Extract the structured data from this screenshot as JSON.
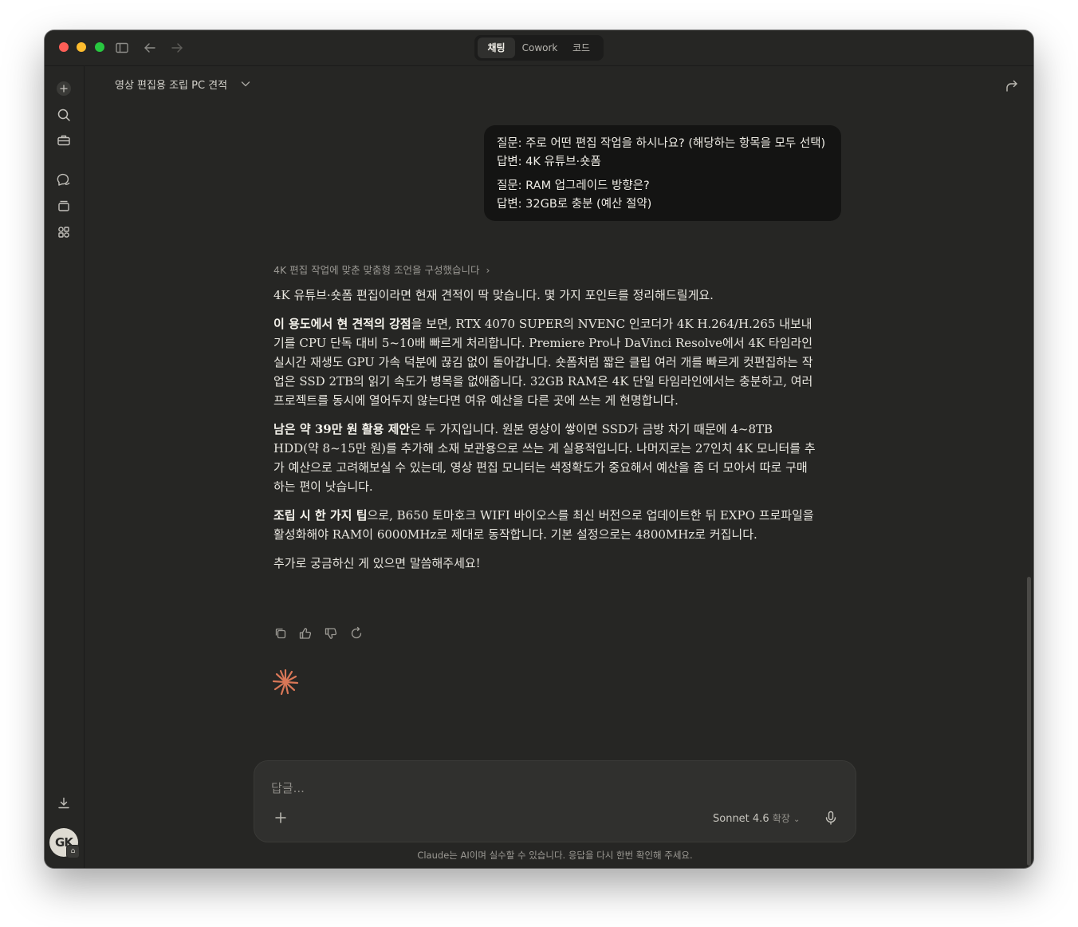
{
  "titlebar": {
    "modes": [
      "채팅",
      "Cowork",
      "코드"
    ],
    "active_mode": "채팅"
  },
  "conversation": {
    "title": "영상 편집용 조립 PC 견적"
  },
  "user_message": {
    "q1": "질문: 주로 어떤 편집 작업을 하시나요? (해당하는 항목을 모두 선택)",
    "a1": "답변: 4K 유튜브·숏폼",
    "q2": "질문: RAM 업그레이드 방향은?",
    "a2": "답변: 32GB로 충분 (예산 절약)"
  },
  "assistant": {
    "thinking": "4K 편집 작업에 맞춘 맞춤형 조언을 구성했습니다",
    "p1": "4K 유튜브·숏폼 편집이라면 현재 견적이 딱 맞습니다. 몇 가지 포인트를 정리해드릴게요.",
    "p2_bold": "이 용도에서 현 견적의 강점",
    "p2_rest": "을 보면, RTX 4070 SUPER의 NVENC 인코더가 4K H.264/H.265 내보내기를 CPU 단독 대비 5~10배 빠르게 처리합니다. Premiere Pro나 DaVinci Resolve에서 4K 타임라인 실시간 재생도 GPU 가속 덕분에 끊김 없이 돌아갑니다. 숏폼처럼 짧은 클립 여러 개를 빠르게 컷편집하는 작업은 SSD 2TB의 읽기 속도가 병목을 없애줍니다. 32GB RAM은 4K 단일 타임라인에서는 충분하고, 여러 프로젝트를 동시에 열어두지 않는다면 여유 예산을 다른 곳에 쓰는 게 현명합니다.",
    "p3_bold": "남은 약 39만 원 활용 제안",
    "p3_rest": "은 두 가지입니다. 원본 영상이 쌓이면 SSD가 금방 차기 때문에 4~8TB HDD(약 8~15만 원)를 추가해 소재 보관용으로 쓰는 게 실용적입니다. 나머지로는 27인치 4K 모니터를 추가 예산으로 고려해보실 수 있는데, 영상 편집 모니터는 색정확도가 중요해서 예산을 좀 더 모아서 따로 구매하는 편이 낫습니다.",
    "p4_bold": "조립 시 한 가지 팁",
    "p4_rest": "으로, B650 토마호크 WIFI 바이오스를 최신 버전으로 업데이트한 뒤 EXPO 프로파일을 활성화해야 RAM이 6000MHz로 제대로 동작합니다. 기본 설정으로는 4800MHz로 커집니다.",
    "p5": "추가로 궁금하신 게 있으면 말씀해주세요!"
  },
  "composer": {
    "placeholder": "답글...",
    "model": "Sonnet 4.6",
    "mode": "확장"
  },
  "avatar_initials": "GK",
  "disclaimer": "Claude는 AI이며 실수할 수 있습니다. 응답을 다시 한번 확인해 주세요.",
  "colors": {
    "background": "#262624",
    "accent": "#d97757",
    "user_bubble": "#141413"
  }
}
